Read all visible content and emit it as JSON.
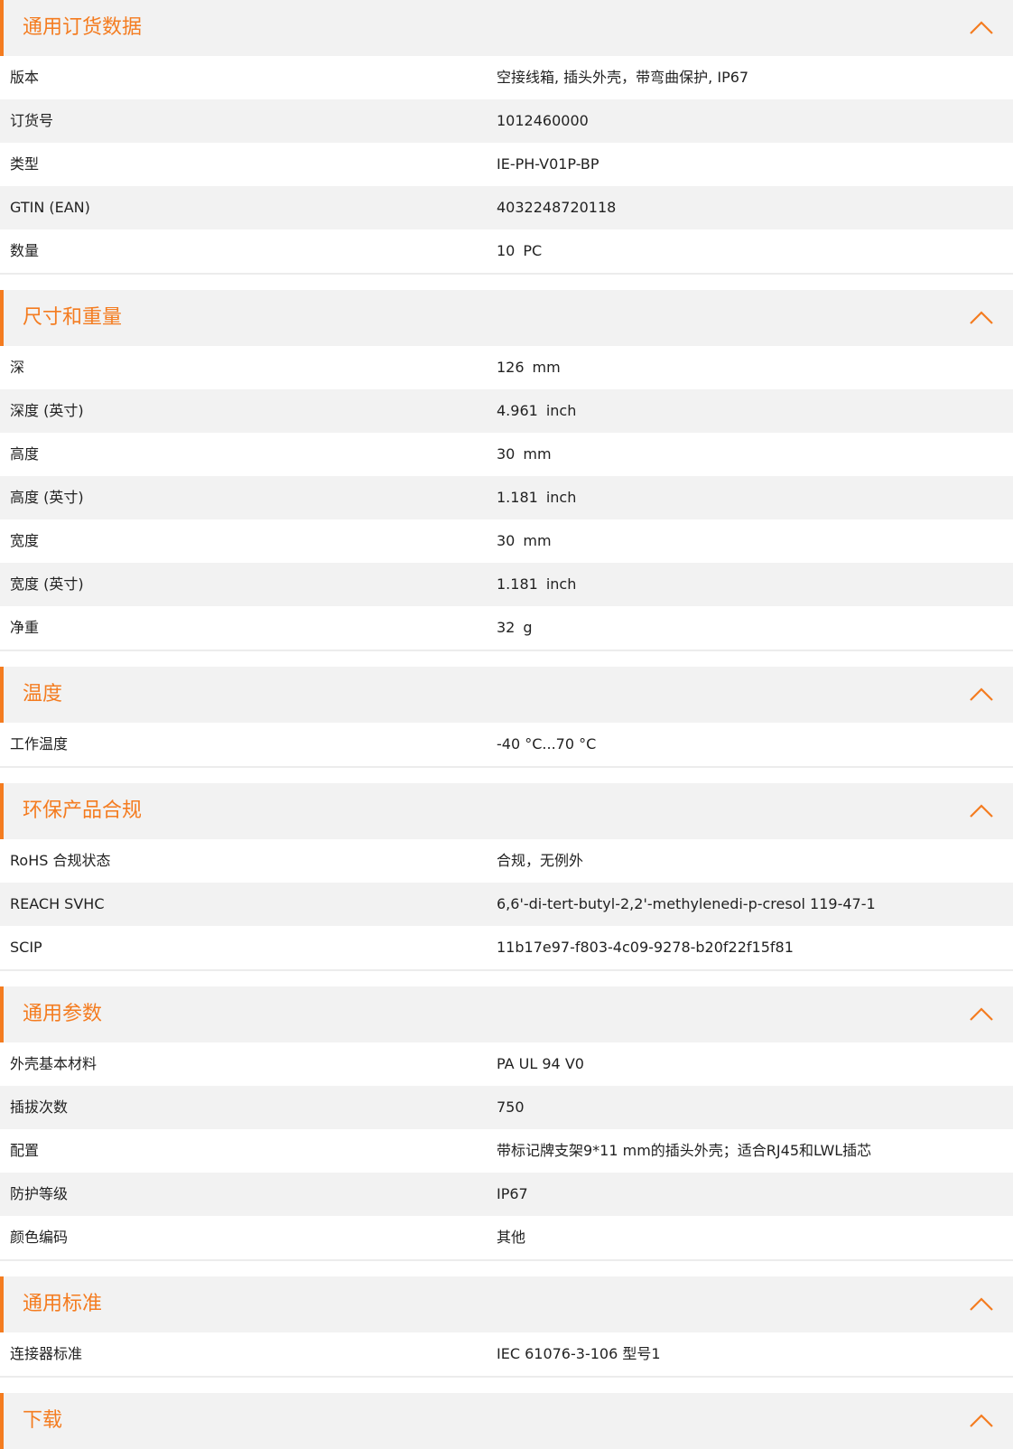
{
  "sections": [
    {
      "title": "通用订货数据",
      "rows": [
        {
          "label": "版本",
          "value": "空接线箱, 插头外壳，带弯曲保护, IP67"
        },
        {
          "label": "订货号",
          "value": "1012460000"
        },
        {
          "label": "类型",
          "value": "IE-PH-V01P-BP"
        },
        {
          "label": "GTIN (EAN)",
          "value": "4032248720118"
        },
        {
          "label": "数量",
          "value": "10",
          "unit": "PC"
        }
      ]
    },
    {
      "title": "尺寸和重量",
      "rows": [
        {
          "label": "深",
          "value": "126",
          "unit": "mm"
        },
        {
          "label": "深度 (英寸)",
          "value": "4.961",
          "unit": "inch"
        },
        {
          "label": "高度",
          "value": "30",
          "unit": "mm"
        },
        {
          "label": "高度 (英寸)",
          "value": "1.181",
          "unit": "inch"
        },
        {
          "label": "宽度",
          "value": "30",
          "unit": "mm"
        },
        {
          "label": "宽度 (英寸)",
          "value": "1.181",
          "unit": "inch"
        },
        {
          "label": "净重",
          "value": "32",
          "unit": "g"
        }
      ]
    },
    {
      "title": "温度",
      "rows": [
        {
          "label": "工作温度",
          "value": "-40 °C...70 °C"
        }
      ]
    },
    {
      "title": "环保产品合规",
      "rows": [
        {
          "label": "RoHS 合规状态",
          "value": "合规，无例外"
        },
        {
          "label": "REACH SVHC",
          "value": "6,6'-di-tert-butyl-2,2'-methylenedi-p-cresol 119-47-1"
        },
        {
          "label": "SCIP",
          "value": "11b17e97-f803-4c09-9278-b20f22f15f81"
        }
      ]
    },
    {
      "title": "通用参数",
      "rows": [
        {
          "label": "外壳基本材料",
          "value": "PA UL 94 V0"
        },
        {
          "label": "插拔次数",
          "value": "750"
        },
        {
          "label": "配置",
          "value": "带标记牌支架9*11 mm的插头外壳；适合RJ45和LWL插芯"
        },
        {
          "label": "防护等级",
          "value": "IP67"
        },
        {
          "label": "颜色编码",
          "value": "其他"
        }
      ]
    },
    {
      "title": "通用标准",
      "rows": [
        {
          "label": "连接器标准",
          "value": "IEC 61076-3-106 型号1"
        }
      ]
    },
    {
      "title": "下载",
      "rows": []
    }
  ],
  "icons": {
    "collapse": "chevron-up-icon"
  },
  "colors": {
    "accent": "#f47c20",
    "header_bg": "#f2f2f2",
    "row_alt_bg": "#f2f2f2",
    "text": "#222222"
  }
}
